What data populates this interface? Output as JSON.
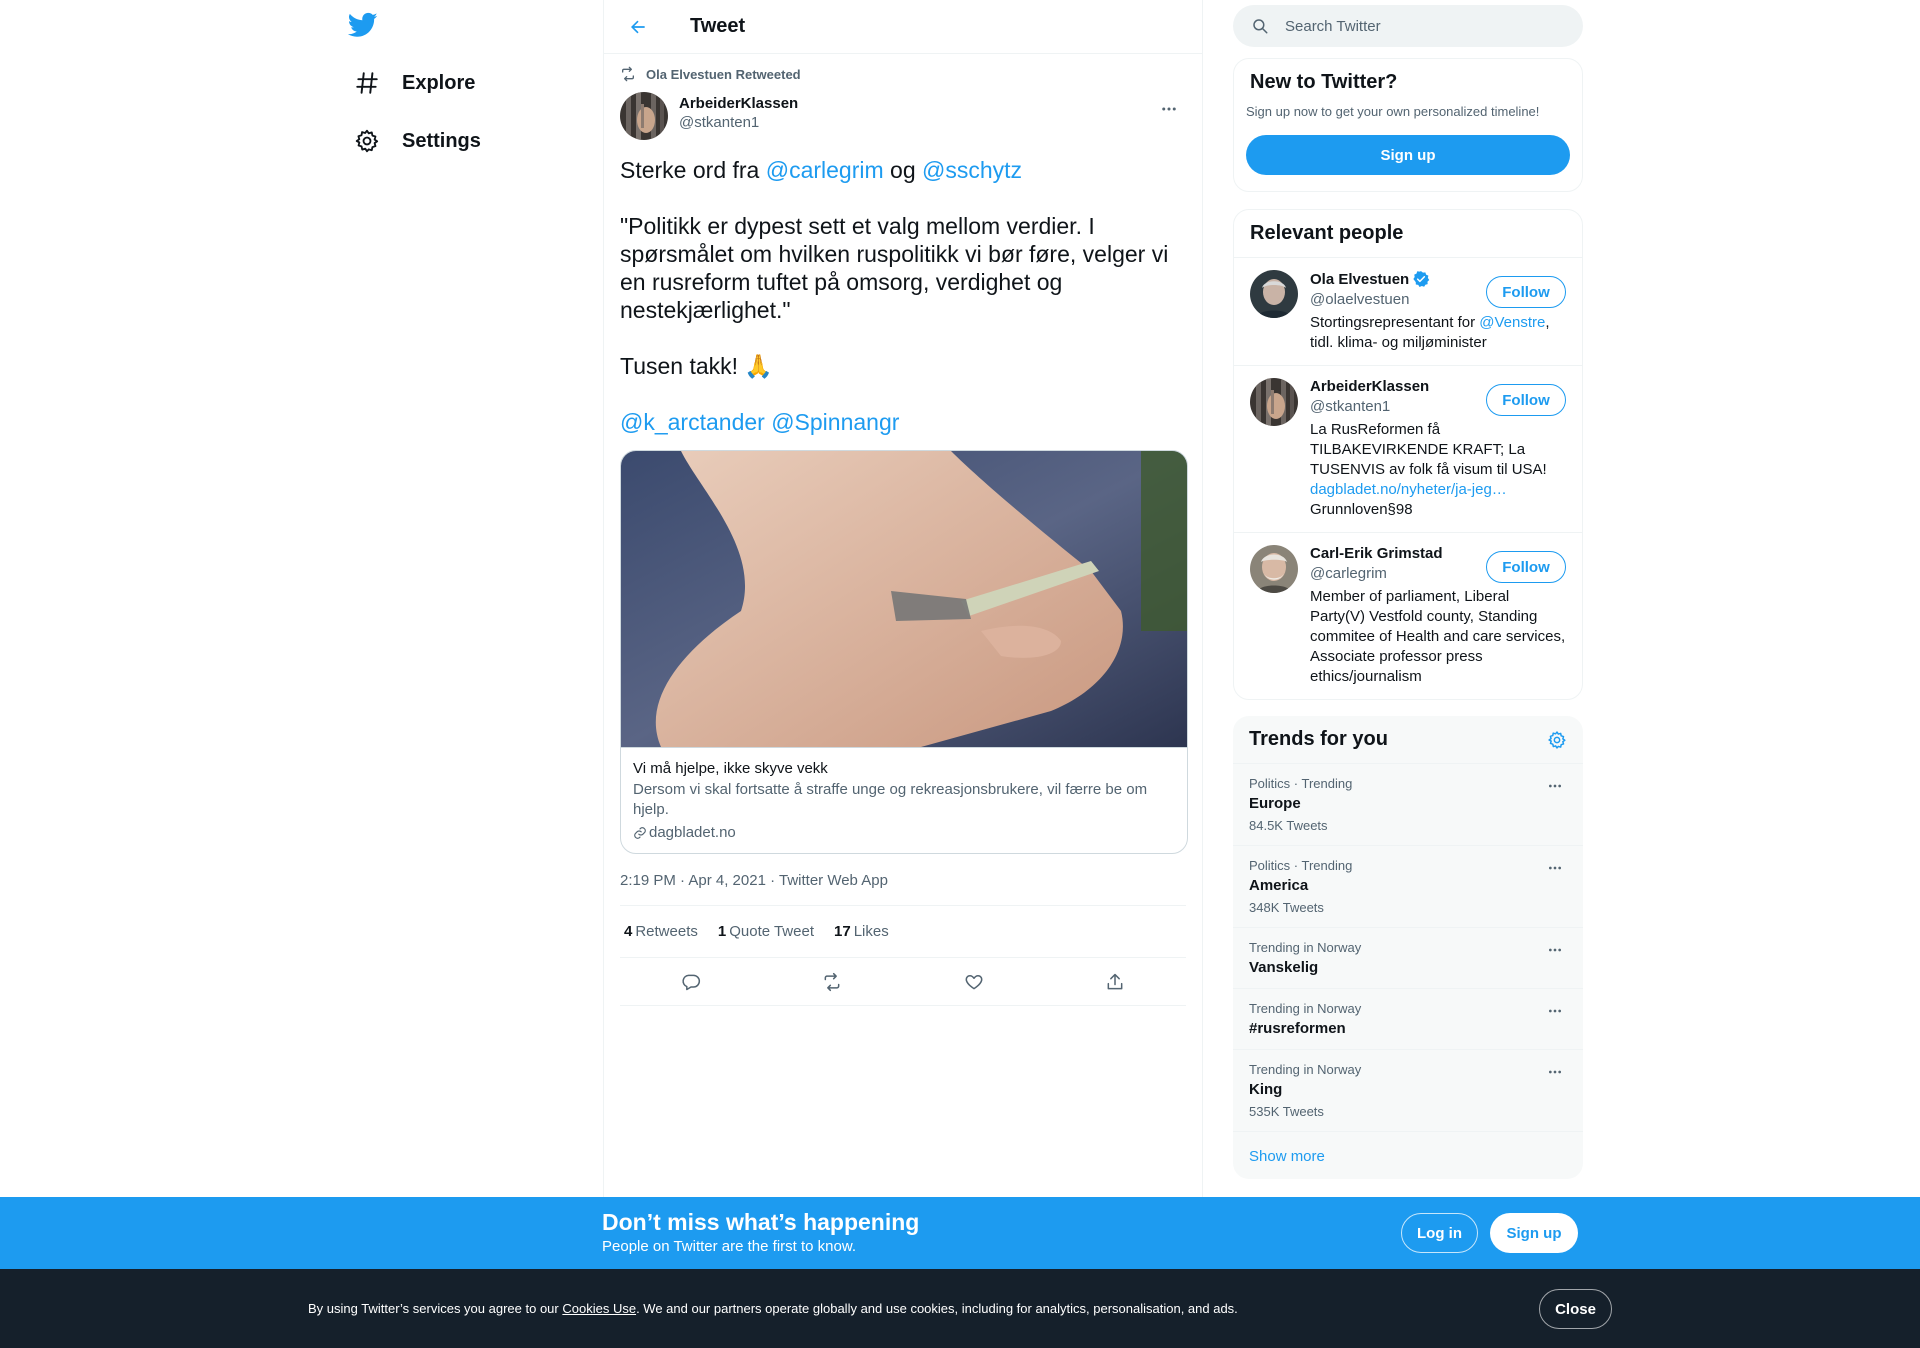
{
  "nav": {
    "items": [
      {
        "label": "Explore",
        "icon": "hashtag-icon"
      },
      {
        "label": "Settings",
        "icon": "gear-icon"
      }
    ]
  },
  "header": {
    "title": "Tweet"
  },
  "tweet": {
    "retweeted_by": "Ola Elvestuen Retweeted",
    "author": {
      "name": "ArbeiderKlassen",
      "handle": "@stkanten1"
    },
    "text": {
      "line1_prefix": "Sterke ord fra ",
      "mention1": "@carlegrim",
      "line1_mid": " og ",
      "mention2": "@sschytz",
      "quote": "\"Politikk er dypest sett et valg mellom verdier. I spørsmålet om hvilken ruspolitikk vi bør føre, velger vi en rusreform tuftet på omsorg, verdighet og nestekjærlighet.\"",
      "thanks": "Tusen takk! 🙏",
      "mention3": "@k_arctander",
      "mention4": "@Spinnangr"
    },
    "card": {
      "title": "Vi må hjelpe, ikke skyve vekk",
      "description": "Dersom vi skal fortsatte å straffe unge og rekreasjonsbrukere, vil færre be om hjelp.",
      "domain": "dagbladet.no"
    },
    "timestamp": "2:19 PM · Apr 4, 2021 · Twitter Web App",
    "stats": {
      "retweets_count": "4",
      "retweets_label": "Retweets",
      "quotes_count": "1",
      "quotes_label": "Quote Tweet",
      "likes_count": "17",
      "likes_label": "Likes"
    }
  },
  "search": {
    "placeholder": "Search Twitter"
  },
  "new_to_twitter": {
    "title": "New to Twitter?",
    "subtitle": "Sign up now to get your own personalized timeline!",
    "button": "Sign up"
  },
  "relevant_people": {
    "title": "Relevant people",
    "follow_label": "Follow",
    "people": [
      {
        "name": "Ola Elvestuen",
        "handle": "@olaelvestuen",
        "bio_prefix": "Stortingsrepresentant for ",
        "bio_link": "@Venstre",
        "bio_suffix": ", tidl. klima- og miljøminister"
      },
      {
        "name": "ArbeiderKlassen",
        "handle": "@stkanten1",
        "bio_prefix": "La RusReformen få TILBAKEVIRKENDE KRAFT; La TUSENVIS av folk få visum til USA! ",
        "bio_link": "dagbladet.no/nyheter/ja-jeg…",
        "bio_suffix": " Grunnloven§98"
      },
      {
        "name": "Carl-Erik Grimstad",
        "handle": "@carlegrim",
        "bio": "Member of parliament, Liberal Party(V) Vestfold county, Standing commitee of Health and care services, Associate professor press ethics/journalism"
      }
    ]
  },
  "trends": {
    "title": "Trends for you",
    "items": [
      {
        "meta": "Politics · Trending",
        "name": "Europe",
        "count": "84.5K Tweets"
      },
      {
        "meta": "Politics · Trending",
        "name": "America",
        "count": "348K Tweets"
      },
      {
        "meta": "Trending in Norway",
        "name": "Vanskelig",
        "count": ""
      },
      {
        "meta": "Trending in Norway",
        "name": "#rusreformen",
        "count": ""
      },
      {
        "meta": "Trending in Norway",
        "name": "King",
        "count": "535K Tweets"
      }
    ],
    "show_more": "Show more"
  },
  "bottom_bar": {
    "title": "Don’t miss what’s happening",
    "subtitle": "People on Twitter are the first to know.",
    "login": "Log in",
    "signup": "Sign up"
  },
  "cookie": {
    "prefix": "By using Twitter’s services you agree to our ",
    "link": "Cookies Use",
    "suffix": ". We and our partners operate globally and use cookies, including for analytics, personalisation, and ads.",
    "close": "Close"
  },
  "colors": {
    "accent": "#1d9bf0",
    "text": "#0f1419",
    "secondary": "#536471",
    "cookie_bg": "#15202b"
  }
}
